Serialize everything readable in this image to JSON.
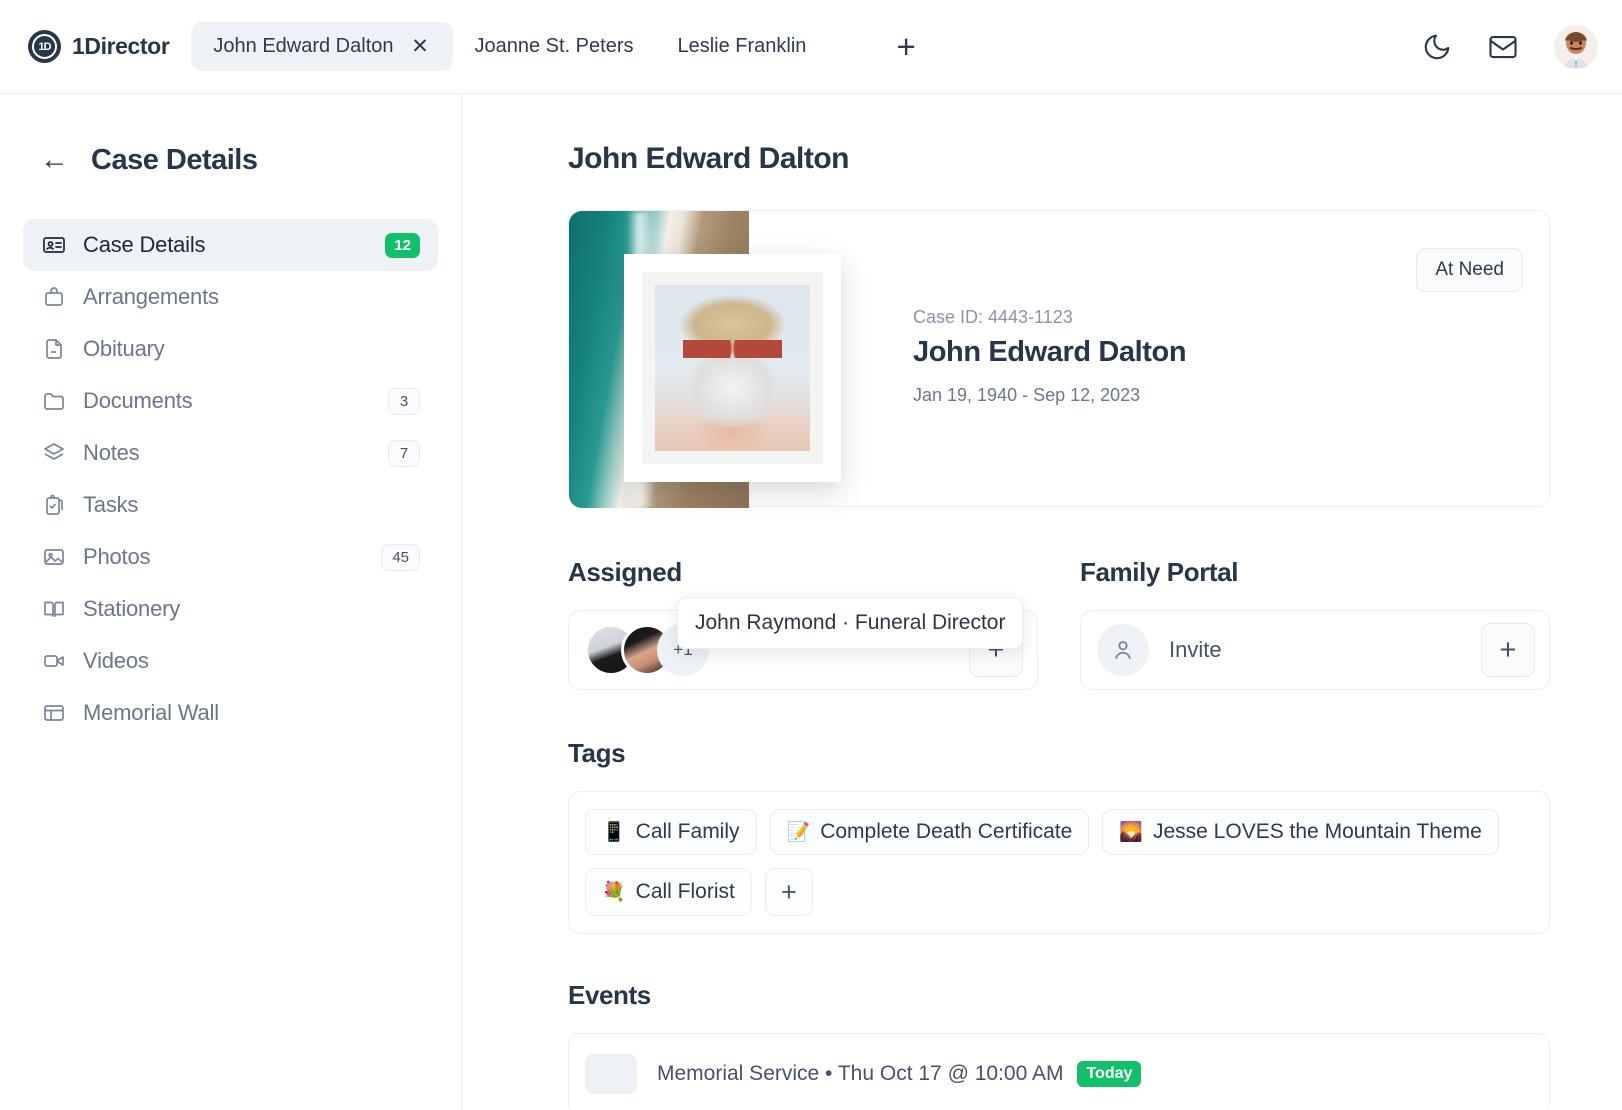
{
  "app": {
    "brand_name": "1Director",
    "brand_logo_text": "1D"
  },
  "topbar": {
    "tabs": [
      {
        "label": "John Edward Dalton",
        "active": true,
        "close_glyph": "✕"
      },
      {
        "label": "Joanne St. Peters",
        "active": false
      },
      {
        "label": "Leslie Franklin",
        "active": false
      }
    ],
    "add_tab_glyph": "+",
    "icons": {
      "dark_mode": "moon-icon",
      "messages": "envelope-icon",
      "profile": "user-avatar"
    }
  },
  "sidebar": {
    "back_glyph": "←",
    "title": "Case Details",
    "items": [
      {
        "label": "Case Details",
        "icon": "contact-card-icon",
        "badge": "12",
        "badge_style": "green",
        "active": true
      },
      {
        "label": "Arrangements",
        "icon": "briefcase-icon",
        "badge": "",
        "badge_style": "none",
        "active": false
      },
      {
        "label": "Obituary",
        "icon": "document-icon",
        "badge": "",
        "badge_style": "none",
        "active": false
      },
      {
        "label": "Documents",
        "icon": "folder-icon",
        "badge": "3",
        "badge_style": "plain",
        "active": false
      },
      {
        "label": "Notes",
        "icon": "layers-icon",
        "badge": "7",
        "badge_style": "plain",
        "active": false
      },
      {
        "label": "Tasks",
        "icon": "clipboard-icon",
        "badge": "",
        "badge_style": "none",
        "active": false
      },
      {
        "label": "Photos",
        "icon": "image-icon",
        "badge": "45",
        "badge_style": "plain",
        "active": false
      },
      {
        "label": "Stationery",
        "icon": "book-icon",
        "badge": "",
        "badge_style": "none",
        "active": false
      },
      {
        "label": "Videos",
        "icon": "video-camera-icon",
        "badge": "",
        "badge_style": "none",
        "active": false
      },
      {
        "label": "Memorial Wall",
        "icon": "window-icon",
        "badge": "",
        "badge_style": "none",
        "active": false
      }
    ]
  },
  "main": {
    "page_title": "John Edward Dalton",
    "case_card": {
      "case_id_label": "Case ID: 4443-1123",
      "name": "John Edward Dalton",
      "dates": "Jan 19, 1940 - Sep 12, 2023",
      "status": "At Need"
    },
    "assigned": {
      "title": "Assigned",
      "overflow_count": "+1",
      "tooltip": "John Raymond · Funeral Director",
      "add_glyph": "+"
    },
    "family_portal": {
      "title": "Family Portal",
      "invite_label": "Invite",
      "add_glyph": "+"
    },
    "tags": {
      "title": "Tags",
      "items": [
        {
          "emoji": "📱",
          "label": "Call Family"
        },
        {
          "emoji": "📝",
          "label": "Complete Death Certificate"
        },
        {
          "emoji": "🌄",
          "label": "Jesse LOVES the Mountain Theme"
        },
        {
          "emoji": "💐",
          "label": "Call Florist"
        }
      ],
      "add_glyph": "+"
    },
    "events": {
      "title": "Events",
      "items": [
        {
          "text": "Memorial Service • Thu Oct 17 @ 10:00 AM",
          "badge": "Today"
        }
      ]
    }
  },
  "colors": {
    "accent_green": "#12c06a",
    "text_dark": "#27364b",
    "text_muted": "#6b778c",
    "panel_border": "#eceff3",
    "active_bg": "#eef1f6"
  }
}
